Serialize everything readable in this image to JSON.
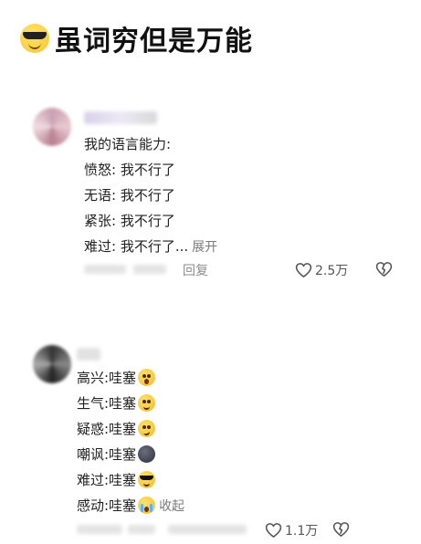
{
  "title": "虽词穷但是万能",
  "title_icon": "sunglasses-face-icon",
  "comments": [
    {
      "lines": [
        {
          "text": "我的语言能力:"
        },
        {
          "text": "愤怒:  我不行了"
        },
        {
          "text": "无语:  我不行了"
        },
        {
          "text": "紧张:  我不行了"
        },
        {
          "text": "难过:  我不行了..."
        }
      ],
      "expand_label": "展开",
      "reply_label": "回复",
      "likes": "2.5万"
    },
    {
      "lines": [
        {
          "text": "高兴:哇塞",
          "icon": "surprised-face-icon"
        },
        {
          "text": "生气:哇塞",
          "icon": "smiling-face-icon"
        },
        {
          "text": "疑惑:哇塞",
          "icon": "woozy-face-icon"
        },
        {
          "text": "嘲讽:哇塞",
          "icon": "dark-face-icon"
        },
        {
          "text": "难过:哇塞",
          "icon": "sunglasses-face-icon"
        },
        {
          "text": "感动:哇塞",
          "icon": "crying-face-icon"
        }
      ],
      "collapse_label": "收起",
      "likes": "1.1万"
    }
  ]
}
